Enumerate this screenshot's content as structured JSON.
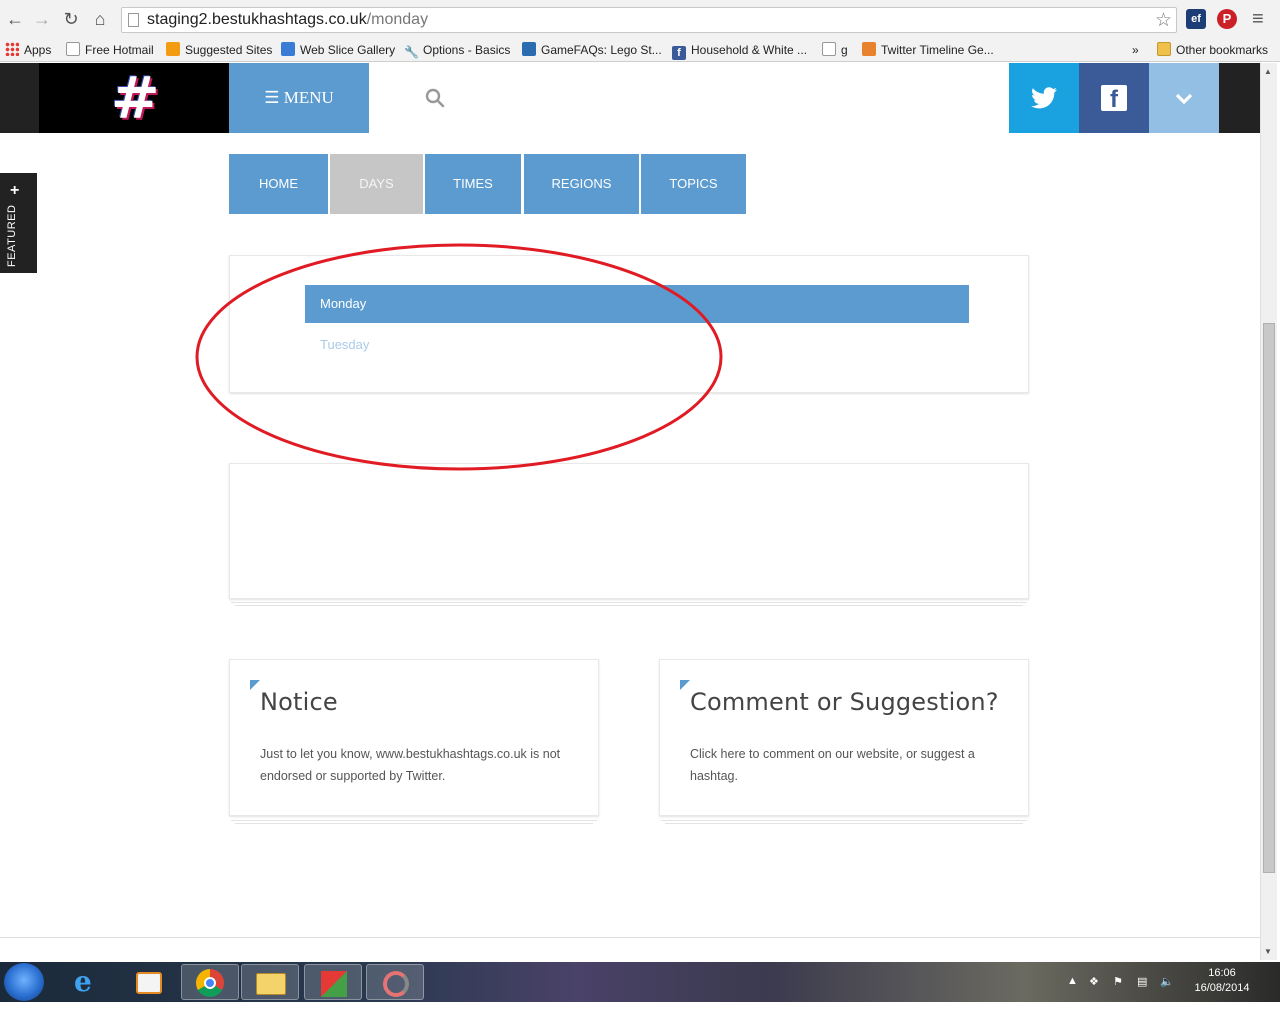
{
  "browser": {
    "url_host": "staging2.bestukhashtags.co.uk",
    "url_path": "/monday",
    "extensions": [
      "ef"
    ],
    "bookmarks": [
      {
        "label": "Apps",
        "icon": "apps-grid-icon"
      },
      {
        "label": "Free Hotmail",
        "icon": "page-icon"
      },
      {
        "label": "Suggested Sites",
        "icon": "suggested-sites-icon"
      },
      {
        "label": "Web Slice Gallery",
        "icon": "ie-icon"
      },
      {
        "label": "Options - Basics",
        "icon": "wrench-icon"
      },
      {
        "label": "GameFAQs: Lego St...",
        "icon": "gamefaqs-icon"
      },
      {
        "label": "Household & White ...",
        "icon": "facebook-icon"
      },
      {
        "label": "g",
        "icon": "runner-icon"
      },
      {
        "label": "Twitter Timeline Ge...",
        "icon": "joomla-icon"
      }
    ],
    "overflow_label": "»",
    "other_bookmarks": "Other bookmarks"
  },
  "site": {
    "logo_symbol": "#",
    "menu_label": "MENU",
    "featured_label": "FEATURED",
    "featured_plus": "+",
    "tabs": [
      {
        "label": "HOME",
        "active": false
      },
      {
        "label": "DAYS",
        "active": true
      },
      {
        "label": "TIMES",
        "active": false
      },
      {
        "label": "REGIONS",
        "active": false
      },
      {
        "label": "TOPICS",
        "active": false
      }
    ],
    "days": [
      {
        "label": "Monday",
        "active": true
      },
      {
        "label": "Tuesday",
        "active": false
      }
    ],
    "notice": {
      "title": "Notice",
      "text": "Just to let you know, www.bestukhashtags.co.uk is not endorsed or supported by Twitter."
    },
    "comment": {
      "title": "Comment or Suggestion?",
      "text": "Click here to comment on our website, or suggest a hashtag."
    },
    "colors": {
      "accent": "#5b9bd0",
      "twitter": "#1aa1e0",
      "facebook": "#3b5a98",
      "annotation": "#e01b24"
    }
  },
  "taskbar": {
    "time": "16:06",
    "date": "16/08/2014"
  }
}
